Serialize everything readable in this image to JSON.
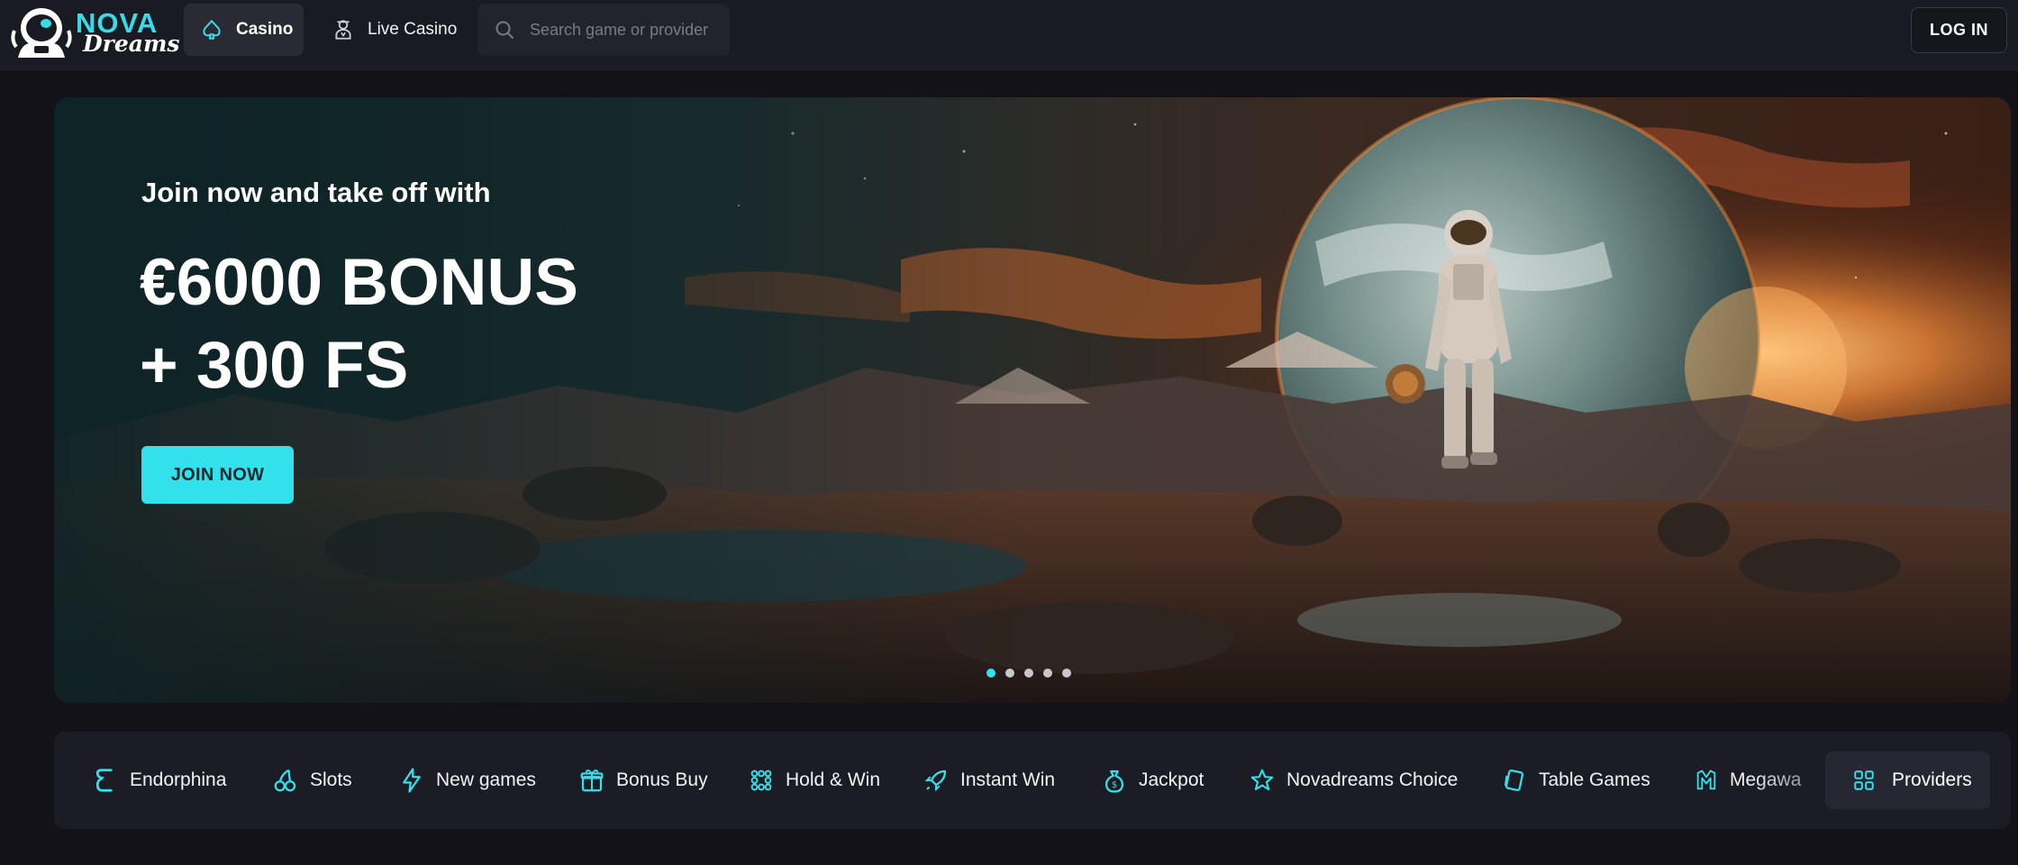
{
  "brand": {
    "name_top": "NOVA",
    "name_bottom": "Dreams"
  },
  "header": {
    "nav": [
      {
        "label": "Casino",
        "icon": "spade-icon",
        "active": true
      },
      {
        "label": "Live Casino",
        "icon": "dealer-icon",
        "active": false
      }
    ],
    "search": {
      "placeholder": "Search game or provider",
      "value": ""
    },
    "login_label": "LOG IN"
  },
  "hero": {
    "pre_title": "Join now and take off with",
    "headline_line1": "€6000 BONUS",
    "headline_line2": "+ 300 FS",
    "cta_label": "JOIN NOW",
    "slides_total": 5,
    "active_slide": 1
  },
  "categories": [
    {
      "label": "Endorphina",
      "icon": "endorphina-icon"
    },
    {
      "label": "Slots",
      "icon": "cherries-icon"
    },
    {
      "label": "New games",
      "icon": "lightning-icon"
    },
    {
      "label": "Bonus Buy",
      "icon": "gift-icon"
    },
    {
      "label": "Hold & Win",
      "icon": "dots-grid-icon"
    },
    {
      "label": "Instant Win",
      "icon": "rocket-icon"
    },
    {
      "label": "Jackpot",
      "icon": "money-bag-icon"
    },
    {
      "label": "Novadreams Choice",
      "icon": "star-icon"
    },
    {
      "label": "Table Games",
      "icon": "cards-icon"
    },
    {
      "label": "Megawa",
      "icon": "megaways-icon"
    }
  ],
  "providers_label": "Providers",
  "colors": {
    "accent": "#33e1ec",
    "background": "#121218",
    "header": "#1a1a22",
    "panel": "#1c1c25"
  }
}
